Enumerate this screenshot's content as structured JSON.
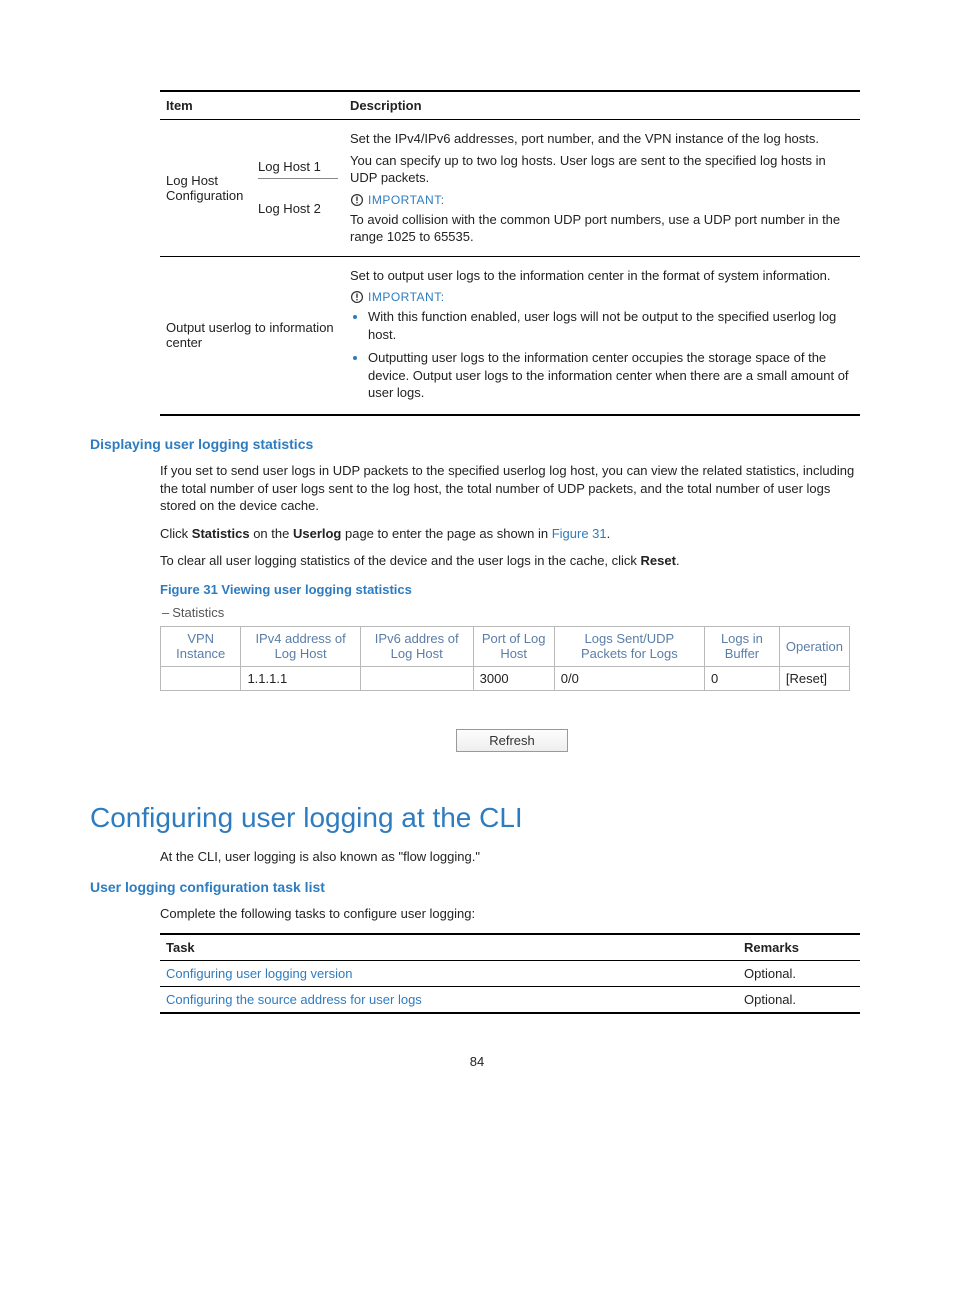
{
  "desc_table": {
    "headers": {
      "item": "Item",
      "description": "Description"
    },
    "row1": {
      "item_group": "Log Host Configuration",
      "host1_label": "Log Host 1",
      "host2_label": "Log Host 2",
      "para1": "Set the IPv4/IPv6 addresses, port number, and the VPN instance of the log hosts.",
      "para2": "You can specify up to two log hosts. User logs are sent to the specified log hosts in UDP packets.",
      "important_label": "IMPORTANT:",
      "para3": "To avoid collision with the common UDP port numbers, use a UDP port number in the range 1025 to 65535."
    },
    "row2": {
      "item": "Output userlog to information center",
      "para1": "Set to output user logs to the information center in the format of system information.",
      "important_label": "IMPORTANT:",
      "bullet1": "With this function enabled, user logs will not be output to the specified userlog log host.",
      "bullet2": "Outputting user logs to the information center occupies the storage space of the device. Output user logs to the information center when there are a small amount of user logs."
    }
  },
  "section_stats": {
    "heading": "Displaying user logging statistics",
    "p1": "If you set to send user logs in UDP packets to the specified userlog log host, you can view the related statistics, including the total number of user logs sent to the log host, the total number of UDP packets, and the total number of user logs stored on the device cache.",
    "p2_pre": "Click ",
    "p2_b1": "Statistics",
    "p2_mid": " on the ",
    "p2_b2": "Userlog",
    "p2_post": " page to enter the page as shown in ",
    "p2_link": "Figure 31",
    "p2_end": ".",
    "p3_pre": "To clear all user logging statistics of the device and the user logs in the cache, click ",
    "p3_b": "Reset",
    "p3_end": ".",
    "fig_caption": "Figure 31 Viewing user logging statistics"
  },
  "chart_data": {
    "type": "table",
    "title": "Statistics",
    "columns": [
      "VPN Instance",
      "IPv4 address of Log Host",
      "IPv6 addres of Log Host",
      "Port of Log Host",
      "Logs Sent/UDP Packets for Logs",
      "Logs in Buffer",
      "Operation"
    ],
    "rows": [
      {
        "vpn": "",
        "ipv4": "1.1.1.1",
        "ipv6": "",
        "port": "3000",
        "sent": "0/0",
        "buffer": "0",
        "op": "[Reset]"
      }
    ],
    "refresh_label": "Refresh"
  },
  "section_cli": {
    "heading": "Configuring user logging at the CLI",
    "p1": "At the CLI, user logging is also known as \"flow logging.\"",
    "subheading": "User logging configuration task list",
    "p2": "Complete the following tasks to configure user logging:"
  },
  "task_table": {
    "headers": {
      "task": "Task",
      "remarks": "Remarks"
    },
    "rows": [
      {
        "task": "Configuring user logging version",
        "remarks": "Optional."
      },
      {
        "task": "Configuring the source address for user logs",
        "remarks": "Optional."
      }
    ]
  },
  "page_number": "84"
}
